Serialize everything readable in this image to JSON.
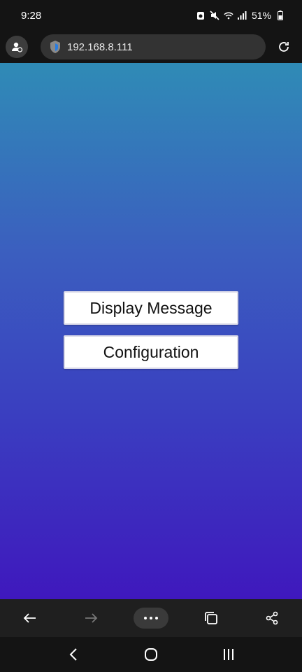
{
  "status_bar": {
    "time": "9:28",
    "battery_percent": "51%",
    "icons": [
      "alarm-icon",
      "mute-icon",
      "wifi-icon",
      "signal-icon",
      "battery-icon"
    ]
  },
  "address_bar": {
    "url": "192.168.8.111",
    "icons": [
      "profile-icon",
      "shield-icon",
      "reload-icon"
    ]
  },
  "page": {
    "background_top": "#2f8bb6",
    "background_bottom": "#3f18bd",
    "buttons": [
      {
        "label": "Display Message"
      },
      {
        "label": "Configuration"
      }
    ]
  },
  "browser_toolbar": {
    "icons": [
      "back-arrow-icon",
      "forward-arrow-icon",
      "more-icon",
      "tabs-icon",
      "share-icon"
    ]
  },
  "system_nav": {
    "icons": [
      "nav-back-icon",
      "home-icon",
      "recent-apps-icon"
    ]
  }
}
